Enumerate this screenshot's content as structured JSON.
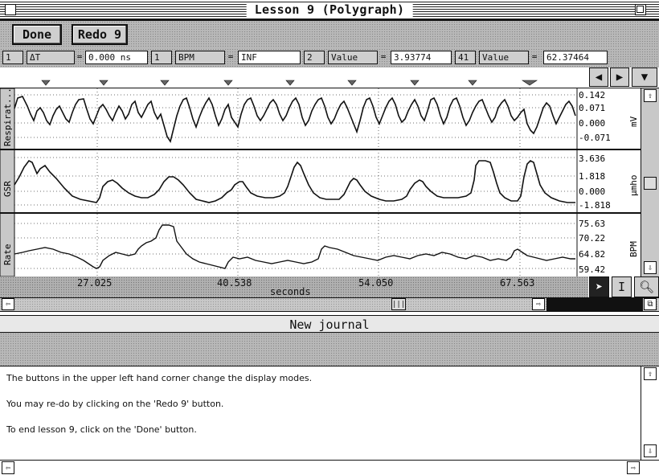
{
  "window": {
    "title": "Lesson  9 (Polygraph)"
  },
  "toolbar": {
    "done_label": "Done",
    "redo_label": "Redo 9"
  },
  "measurements": [
    {
      "channel": "1",
      "type": "ΔT",
      "value": "0.000 ns"
    },
    {
      "channel": "1",
      "type": "BPM",
      "value": "INF"
    },
    {
      "channel": "2",
      "type": "Value",
      "value": "3.93774"
    },
    {
      "channel": "41",
      "type": "Value",
      "value": "62.37464"
    }
  ],
  "channels": [
    {
      "label": "Respirat...",
      "unit": "mV",
      "ticks": [
        "0.142",
        "0.071",
        "0.000",
        "-0.071"
      ]
    },
    {
      "label": "GSR",
      "unit": "µmho",
      "ticks": [
        "3.636",
        "1.818",
        "0.000",
        "-1.818"
      ]
    },
    {
      "label": "Rate",
      "unit": "BPM",
      "ticks": [
        "75.63",
        "70.22",
        "64.82",
        "59.42"
      ]
    }
  ],
  "x_axis": {
    "label": "seconds",
    "ticks": [
      "27.025",
      "40.538",
      "54.050",
      "67.563"
    ]
  },
  "journal": {
    "title": "New journal",
    "lines": [
      "The buttons in the upper left hand corner change the display modes.",
      "You may re-do by clicking on the 'Redo 9' button.",
      "To end lesson 9, click on the 'Done' button."
    ]
  },
  "icons": {
    "close": "close-box-icon",
    "zoom": "zoom-box-icon",
    "left_arrow": "left-arrow-icon",
    "right_arrow": "right-arrow-icon",
    "down_arrow": "down-arrow-icon",
    "pointer": "arrow-pointer-icon",
    "ibeam": "i-beam-icon",
    "magnifier": "magnifier-icon"
  }
}
